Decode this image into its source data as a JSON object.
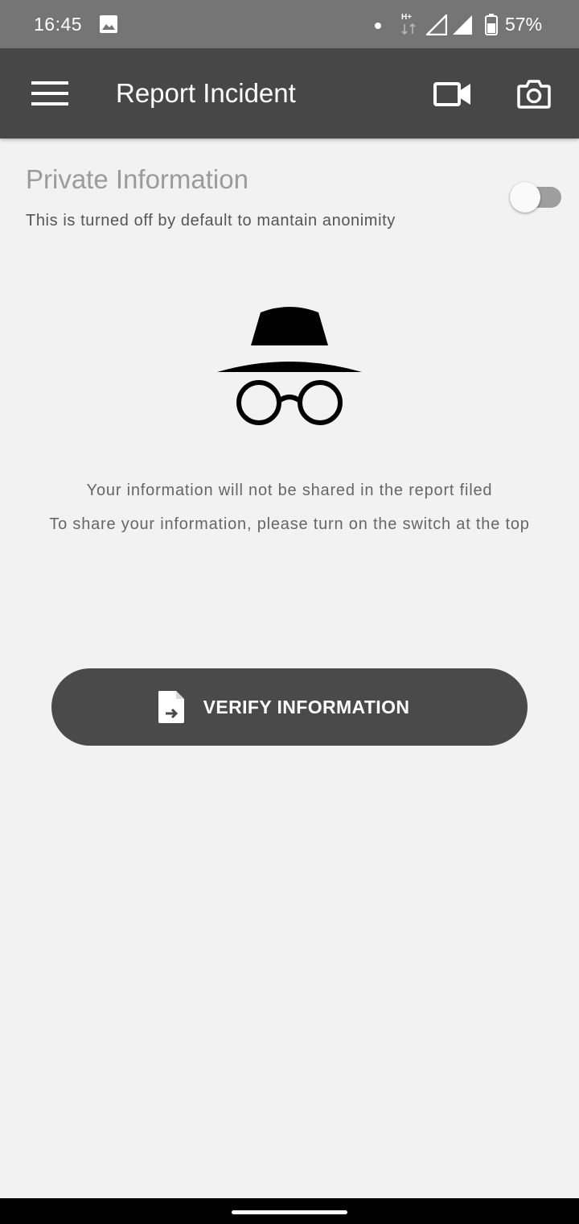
{
  "status_bar": {
    "time": "16:45",
    "network_type": "H+",
    "battery": "57%",
    "icons": [
      "gallery-icon",
      "notification-dot-icon",
      "network-data-icon",
      "signal-icon",
      "battery-icon"
    ]
  },
  "app_bar": {
    "title": "Report Incident",
    "icons": [
      "menu-icon",
      "video-camera-icon",
      "camera-icon"
    ]
  },
  "private_section": {
    "title": "Private Information",
    "subtitle": "This is turned off by default to mantain anonimity",
    "switch_on": false
  },
  "illustration": {
    "icon": "incognito-icon"
  },
  "info": {
    "line1": "Your information will not be shared in the report filed",
    "line2": "To share your information, please turn on the switch at the top"
  },
  "verify_button": {
    "label": "VERIFY INFORMATION",
    "icon": "file-export-icon"
  },
  "colors": {
    "status_bar": "#757575",
    "app_bar": "#474747",
    "background": "#f2f2f2",
    "button": "#4a4a4a",
    "switch_track": "#9e9e9e"
  }
}
